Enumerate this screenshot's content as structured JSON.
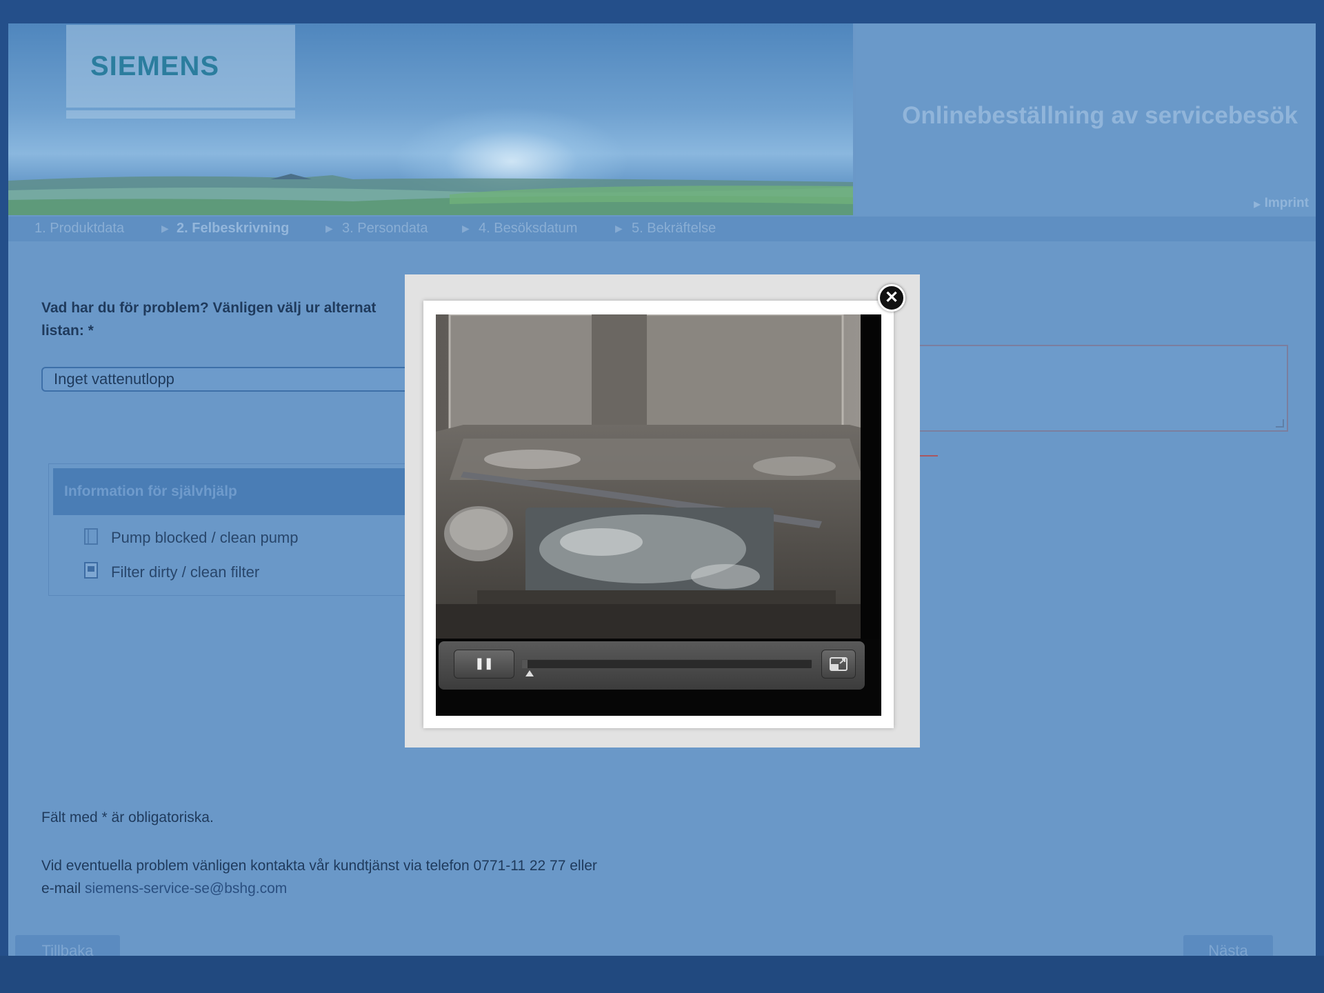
{
  "header": {
    "logo": "SIEMENS",
    "title": "Onlinebeställning av servicebesök",
    "imprint": "Imprint"
  },
  "steps": [
    {
      "label": "1. Produktdata"
    },
    {
      "label": "2. Felbeskrivning"
    },
    {
      "label": "3. Persondata"
    },
    {
      "label": "4. Besöksdatum"
    },
    {
      "label": "5. Bekräftelse"
    }
  ],
  "form": {
    "question": "Vad har du för problem? Vänligen välj ur alternat listan: *",
    "question_line1": "Vad har du för problem? Vänligen välj ur alternat",
    "question_line2": "listan: *",
    "selected_problem": "Inget vattenutlopp"
  },
  "selfhelp": {
    "title": "Information för självhjälp",
    "items": [
      {
        "label": "Pump blocked / clean pump",
        "icon": "document-icon"
      },
      {
        "label": "Filter dirty / clean filter",
        "icon": "media-icon"
      }
    ]
  },
  "footer": {
    "required_note": "Fält med * är obligatoriska.",
    "contact_text": "Vid eventuella problem vänligen kontakta vår kundtjänst via telefon 0771-11 22 77 eller",
    "email_prefix": "e-mail ",
    "email": "siemens-service-se@bshg.com"
  },
  "buttons": {
    "back": "Tillbaka",
    "next": "Nästa"
  },
  "modal": {
    "close_symbol": "✕",
    "player": {
      "pause_symbol": "❚❚",
      "progress": 0.02
    }
  }
}
